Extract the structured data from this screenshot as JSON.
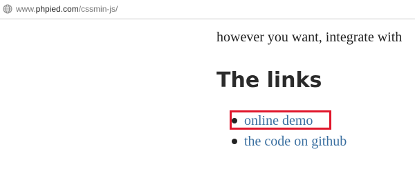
{
  "address_bar": {
    "icon": "globe-icon",
    "url_prefix": "www.",
    "url_host": "phpied.com",
    "url_path": "/cssmin-js/"
  },
  "content": {
    "body_text": "however you want, integrate with",
    "heading": "The links",
    "links": [
      {
        "label": "online demo"
      },
      {
        "label": "the code on github"
      }
    ]
  },
  "annotation": {
    "highlight_color": "#e0162b",
    "highlighted_item": "online demo"
  },
  "colors": {
    "link": "#3a6fa0",
    "text": "#222222"
  }
}
